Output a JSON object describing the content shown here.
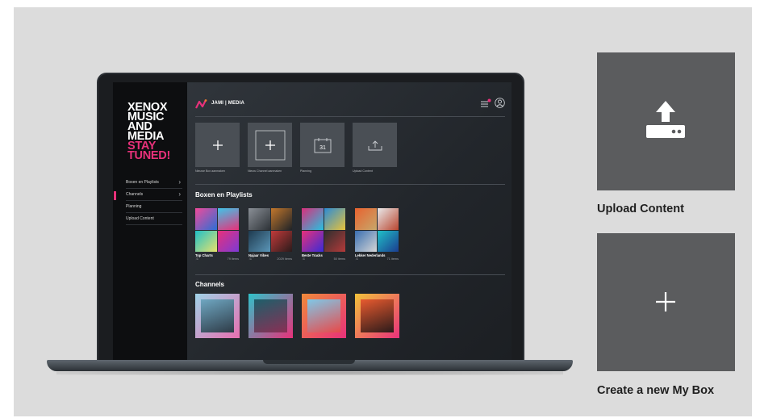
{
  "brand": {
    "lines": [
      "XENOX",
      "MUSIC",
      "AND",
      "MEDIA"
    ],
    "accent_lines": [
      "STAY",
      "TUNED!"
    ],
    "accent_color": "#e8317a"
  },
  "nav": {
    "items": [
      {
        "label": "Boxen en Playlists",
        "icon": "chevron-right-icon"
      },
      {
        "label": "Channels",
        "icon": "chevron-right-icon"
      },
      {
        "label": "Planning"
      },
      {
        "label": "Upload Content"
      }
    ]
  },
  "topbar": {
    "logo_text": "JAMI | MEDIA",
    "icons": [
      "menu-notification-icon",
      "user-icon"
    ]
  },
  "tiles": [
    {
      "label": "Nieuwe Box aanmaken",
      "icon": "plus-icon"
    },
    {
      "label": "Nieuw Channel aanmaken",
      "icon": "plus-square-icon"
    },
    {
      "label": "Planning",
      "icon": "calendar-icon",
      "day": "31"
    },
    {
      "label": "Upload Content",
      "icon": "upload-icon"
    }
  ],
  "sections": {
    "playlists_title": "Boxen en Playlists",
    "channels_title": "Channels"
  },
  "playlists": [
    {
      "name": "Top Charts",
      "count": "79 items"
    },
    {
      "name": "Najaar Vibes",
      "count": "2029 items"
    },
    {
      "name": "Beste Tracks",
      "count": "50 items"
    },
    {
      "name": "Lekker Nederlands",
      "count": "71 items"
    }
  ],
  "right_panel": {
    "upload": {
      "label": "Upload Content",
      "icon": "upload-drive-icon"
    },
    "create": {
      "label": "Create a new My Box",
      "icon": "plus-icon"
    }
  },
  "colors": {
    "accent": "#e8317a",
    "card": "#5b5c5e",
    "backdrop": "#dcdcdc"
  }
}
